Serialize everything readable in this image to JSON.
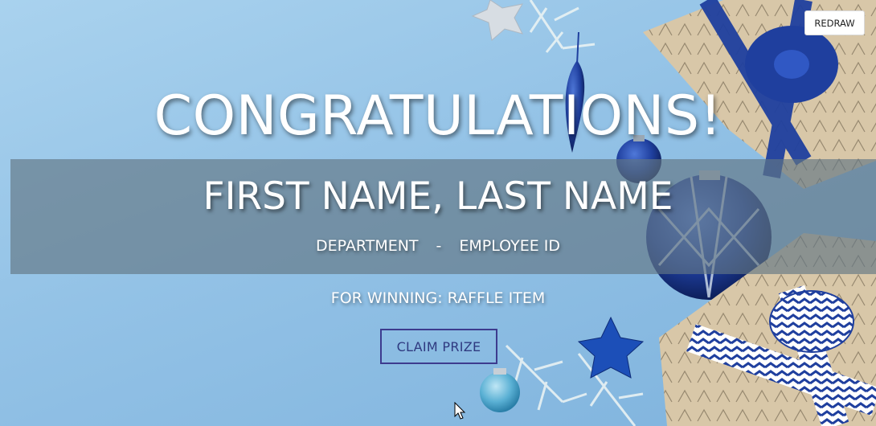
{
  "toolbar": {
    "redraw_label": "REDRAW"
  },
  "hero": {
    "headline": "CONGRATULATIONS!",
    "winner_name": "FIRST NAME, LAST NAME",
    "department": "DEPARTMENT",
    "separator": "-",
    "employee_id": "EMPLOYEE ID",
    "winning_text": "FOR WINNING: RAFFLE ITEM"
  },
  "actions": {
    "claim_label": "CLAIM PRIZE"
  },
  "colors": {
    "background": "#9cc9ea",
    "band": "#627684",
    "claim_border": "#3d3b8e",
    "claim_text": "#2f3a80",
    "ornament_blue": "#1f3f9e",
    "gift_paper": "#d8c7a8"
  },
  "decor": {
    "icons": [
      "silver-star-icon",
      "pine-branch-icon",
      "blue-ornament-icon",
      "gift-box-icon",
      "blue-star-icon",
      "mouse-pointer-icon"
    ]
  }
}
